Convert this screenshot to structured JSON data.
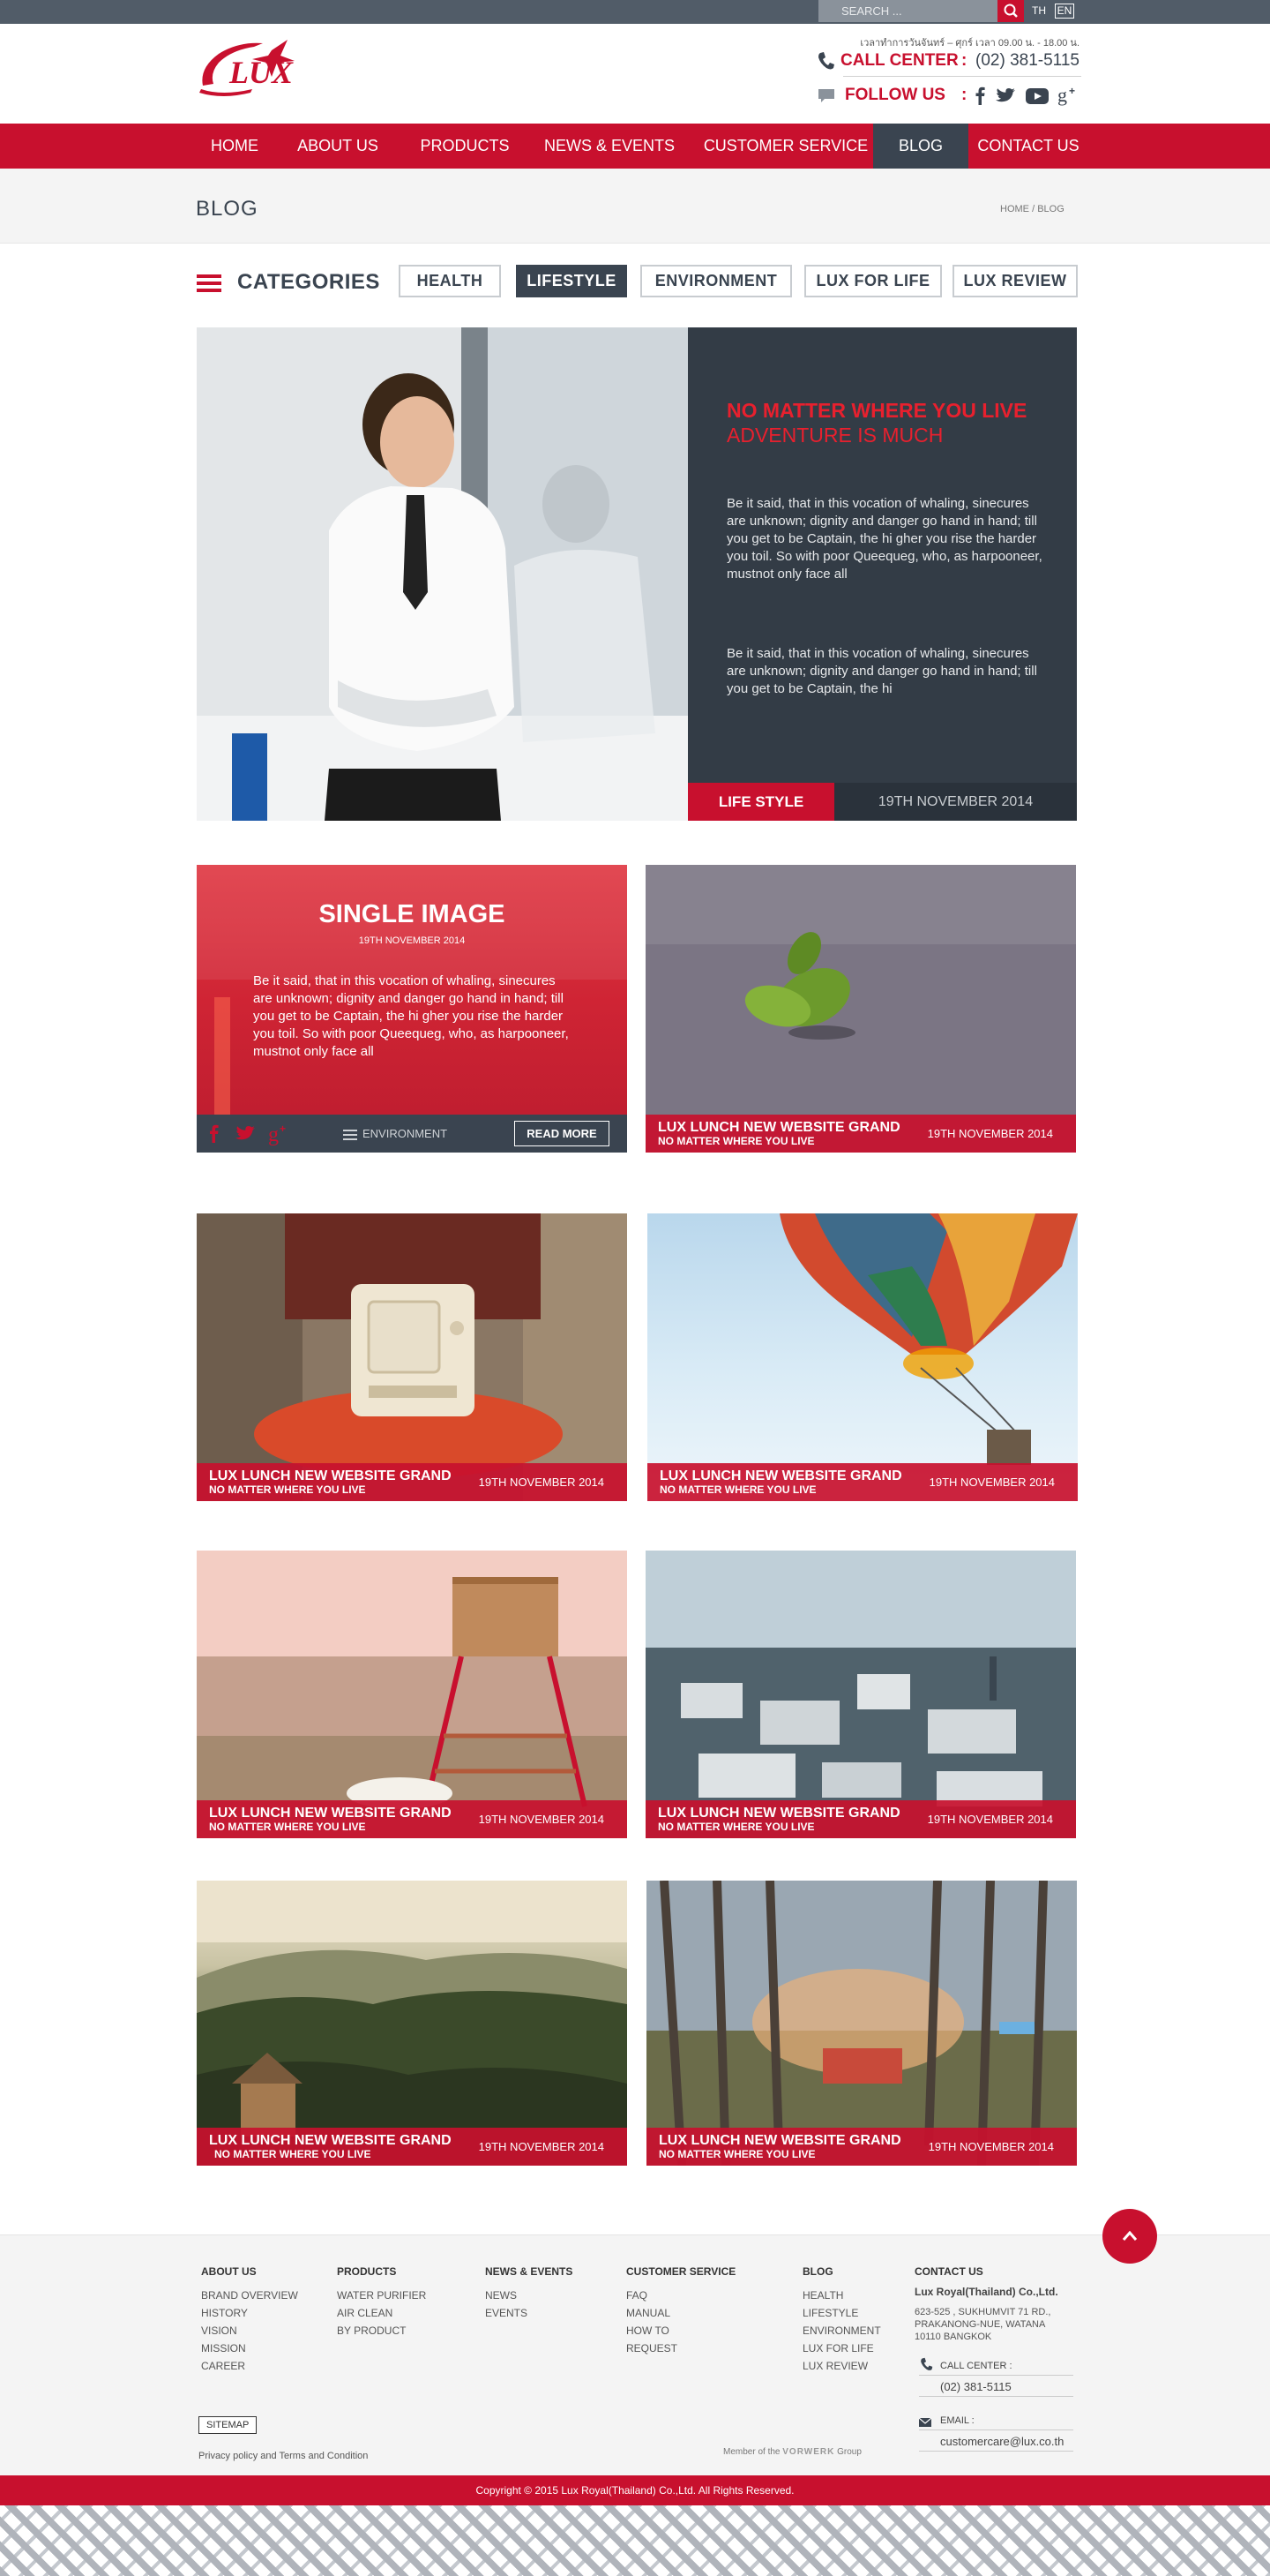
{
  "topbar": {
    "search_placeholder": "SEARCH ...",
    "lang_th": "TH",
    "lang_en": "EN"
  },
  "header": {
    "logo_text": "LUX",
    "hours": "เวลาทำการวันจันทร์ – ศุกร์ เวลา 09.00 น. - 18.00 น.",
    "call_center_label": "CALL CENTER",
    "call_center_sep": ":",
    "call_center_number": "(02) 381-5115",
    "follow_label": "FOLLOW US",
    "follow_sep": ":"
  },
  "nav": {
    "items": [
      "HOME",
      "ABOUT US",
      "PRODUCTS",
      "NEWS & EVENTS",
      "CUSTOMER SERVICE",
      "BLOG",
      "CONTACT US"
    ]
  },
  "page": {
    "title": "BLOG",
    "breadcrumb_home": "HOME",
    "breadcrumb_sep": "/",
    "breadcrumb_current": "BLOG"
  },
  "categories": {
    "label": "CATEGORIES",
    "items": [
      "HEALTH",
      "LIFESTYLE",
      "ENVIRONMENT",
      "LUX FOR LIFE",
      "LUX REVIEW"
    ]
  },
  "featured": {
    "title_line1": "NO MATTER WHERE YOU LIVE",
    "title_line2": "ADVENTURE IS MUCH",
    "para1": "Be it said, that in this vocation of whaling, sinecures are unknown; dignity and danger go hand in hand; till you get to be Captain, the hi gher you rise the harder you toil. So with poor Queequeg, who, as harpooneer, mustnot only face all",
    "para2": "Be it said, that in this vocation of whaling, sinecures are unknown; dignity and danger go hand in hand; till you get to be Captain, the hi",
    "category": "LIFE STYLE",
    "date": "19TH NOVEMBER 2014"
  },
  "single": {
    "title": "SINGLE IMAGE",
    "date": "19TH NOVEMBER 2014",
    "text": "Be it said, that in this vocation of whaling, sinecures are unknown; dignity and danger go hand in hand; till you get to be Captain, the hi gher you rise the harder you toil. So with poor Queequeg, who, as harpooneer, mustnot only face all",
    "category": "ENVIRONMENT",
    "read_more": "READ MORE"
  },
  "cards": [
    {
      "title": "LUX LUNCH NEW WEBSITE GRAND",
      "subtitle": "NO MATTER WHERE YOU LIVE",
      "date": "19TH NOVEMBER 2014"
    },
    {
      "title": "LUX LUNCH NEW WEBSITE GRAND",
      "subtitle": "NO MATTER WHERE YOU LIVE",
      "date": "19TH NOVEMBER 2014"
    },
    {
      "title": "LUX LUNCH NEW WEBSITE GRAND",
      "subtitle": "NO MATTER WHERE YOU LIVE",
      "date": "19TH NOVEMBER 2014"
    },
    {
      "title": "LUX LUNCH NEW WEBSITE GRAND",
      "subtitle": "NO MATTER WHERE YOU LIVE",
      "date": "19TH NOVEMBER 2014"
    },
    {
      "title": "LUX LUNCH NEW WEBSITE GRAND",
      "subtitle": "NO MATTER WHERE YOU LIVE",
      "date": "19TH NOVEMBER 2014"
    },
    {
      "title": "LUX LUNCH NEW WEBSITE GRAND",
      "subtitle": "NO MATTER WHERE YOU LIVE",
      "date": "19TH NOVEMBER 2014"
    },
    {
      "title": "LUX LUNCH NEW WEBSITE GRAND",
      "subtitle": "NO MATTER WHERE YOU LIVE",
      "date": "19TH NOVEMBER 2014"
    }
  ],
  "footer": {
    "about_title": "ABOUT US",
    "about_links": [
      "BRAND OVERVIEW",
      "HISTORY",
      "VISION",
      "MISSION",
      "CAREER"
    ],
    "products_title": "PRODUCTS",
    "products_links": [
      "WATER PURIFIER",
      "AIR CLEAN",
      "BY PRODUCT"
    ],
    "news_title": "NEWS & EVENTS",
    "news_links": [
      "NEWS",
      "EVENTS"
    ],
    "service_title": "CUSTOMER  SERVICE",
    "service_links": [
      "FAQ",
      "MANUAL",
      "HOW TO",
      "REQUEST"
    ],
    "blog_title": "BLOG",
    "blog_links": [
      "HEALTH",
      "LIFESTYLE",
      "ENVIRONMENT",
      "LUX FOR LIFE",
      "LUX REVIEW"
    ],
    "contact_title": "CONTACT US",
    "company": "Lux Royal(Thailand) Co.,Ltd.",
    "address1": "623-525 , SUKHUMVIT 71 RD.,",
    "address2": "PRAKANONG-NUE, WATANA",
    "address3": "10110 BANGKOK",
    "call_label": "CALL CENTER :",
    "call_number": "(02) 381-5115",
    "email_label": "EMAIL :",
    "email": "customercare@lux.co.th",
    "sitemap": "SITEMAP",
    "privacy": "Privacy policy and Terms and Condition",
    "member": "Member of the",
    "member_brand": "VORWERK",
    "member_group": "Group",
    "copyright": "Copyright  © 2015  Lux Royal(Thailand) Co.,Ltd. All Rights Reserved."
  },
  "colors": {
    "brand_red": "#c8102e",
    "dark_slate": "#3a4450",
    "topbar": "#515c68"
  },
  "icons": [
    "search-icon",
    "phone-icon",
    "chat-icon",
    "facebook-icon",
    "twitter-icon",
    "youtube-icon",
    "google-plus-icon",
    "menu-icon",
    "back-to-top-icon",
    "email-icon"
  ]
}
